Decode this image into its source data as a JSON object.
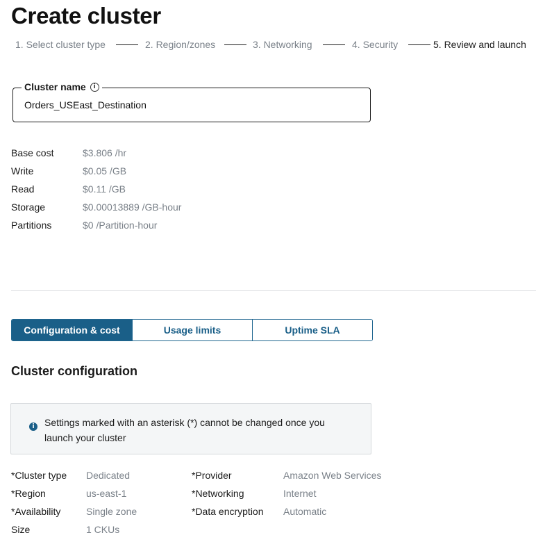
{
  "page_title": "Create cluster",
  "steps": [
    {
      "label": "1. Select cluster type",
      "active": false
    },
    {
      "label": "2. Region/zones",
      "active": false
    },
    {
      "label": "3. Networking",
      "active": false
    },
    {
      "label": "4. Security",
      "active": false
    },
    {
      "label": "5. Review and launch",
      "active": true
    }
  ],
  "cluster_name": {
    "label": "Cluster name",
    "value": "Orders_USEast_Destination"
  },
  "costs": [
    {
      "label": "Base cost",
      "value": "$3.806 /hr"
    },
    {
      "label": "Write",
      "value": "$0.05 /GB"
    },
    {
      "label": "Read",
      "value": "$0.11 /GB"
    },
    {
      "label": "Storage",
      "value": "$0.00013889 /GB-hour"
    },
    {
      "label": "Partitions",
      "value": "$0 /Partition-hour"
    }
  ],
  "tabs": [
    {
      "label": "Configuration & cost",
      "selected": true
    },
    {
      "label": "Usage limits",
      "selected": false
    },
    {
      "label": "Uptime SLA",
      "selected": false
    }
  ],
  "section_title": "Cluster configuration",
  "notice": "Settings marked with an asterisk (*) cannot be changed once you launch your cluster",
  "config": {
    "left": [
      {
        "label": "*Cluster type",
        "value": "Dedicated"
      },
      {
        "label": "*Region",
        "value": "us-east-1"
      },
      {
        "label": "*Availability",
        "value": "Single zone"
      },
      {
        "label": "Size",
        "value": "1 CKUs"
      }
    ],
    "right": [
      {
        "label": "*Provider",
        "value": "Amazon Web Services"
      },
      {
        "label": "*Networking",
        "value": "Internet"
      },
      {
        "label": "*Data encryption",
        "value": "Automatic"
      }
    ]
  },
  "colors": {
    "accent": "#1a5f88",
    "muted_text": "#7a8189",
    "notice_bg": "#f4f6f7"
  }
}
